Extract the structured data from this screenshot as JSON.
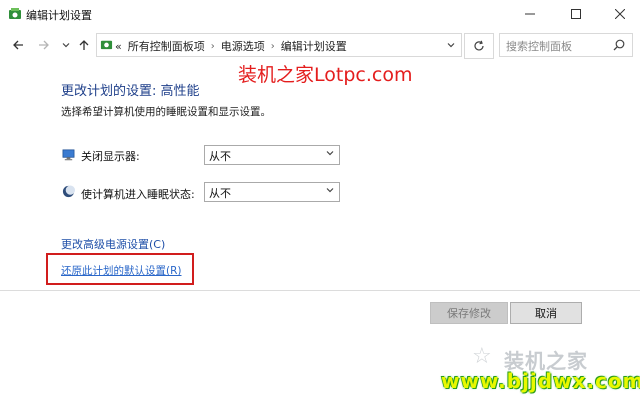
{
  "window": {
    "title": "编辑计划设置",
    "minimize_icon": "minimize-icon",
    "maximize_icon": "maximize-icon",
    "close_icon": "close-icon"
  },
  "addressbar": {
    "overflow": "«",
    "crumbs": [
      "所有控制面板项",
      "电源选项",
      "编辑计划设置"
    ],
    "search_placeholder": "搜索控制面板"
  },
  "watermark_top": "装机之家Lotpc.com",
  "main": {
    "heading": "更改计划的设置: 高性能",
    "subtitle": "选择希望计算机使用的睡眠设置和显示设置。",
    "rows": [
      {
        "label": "关闭显示器:",
        "value": "从不"
      },
      {
        "label": "使计算机进入睡眠状态:",
        "value": "从不"
      }
    ],
    "link_advanced": "更改高级电源设置(C)",
    "link_restore": "还原此计划的默认设置(R)"
  },
  "footer": {
    "save_label": "保存修改",
    "cancel_label": "取消"
  },
  "watermark_bottom": {
    "name": "装机之家",
    "url": "www.bjjdwx.com"
  },
  "colors": {
    "heading": "#1e3f8a",
    "link": "#1f4fa8",
    "highlight_box": "#d11d1d",
    "watermark_red": "#e41d1d"
  }
}
